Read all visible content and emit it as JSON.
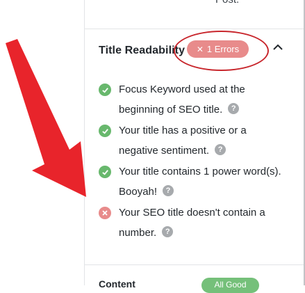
{
  "top_fragment": {
    "text": "Post."
  },
  "section": {
    "title": "Title Readability",
    "error_badge": {
      "icon": "x-icon",
      "label": "1 Errors"
    },
    "toggle_icon": "chevron-up-icon"
  },
  "checks": [
    {
      "status": "pass",
      "lines": [
        "Focus Keyword used at the",
        "beginning of SEO title."
      ]
    },
    {
      "status": "pass",
      "lines": [
        "Your title has a positive or a",
        "negative sentiment."
      ]
    },
    {
      "status": "pass",
      "lines": [
        "Your title contains 1 power word(s).",
        "Booyah!"
      ]
    },
    {
      "status": "fail",
      "lines": [
        "Your SEO title doesn't contain a",
        "number."
      ]
    }
  ],
  "next_section": {
    "label": "Content",
    "pill_label": "All Good"
  },
  "colors": {
    "pass": "#68b86d",
    "fail": "#e88b8b",
    "annotation_red": "#c8262c"
  }
}
